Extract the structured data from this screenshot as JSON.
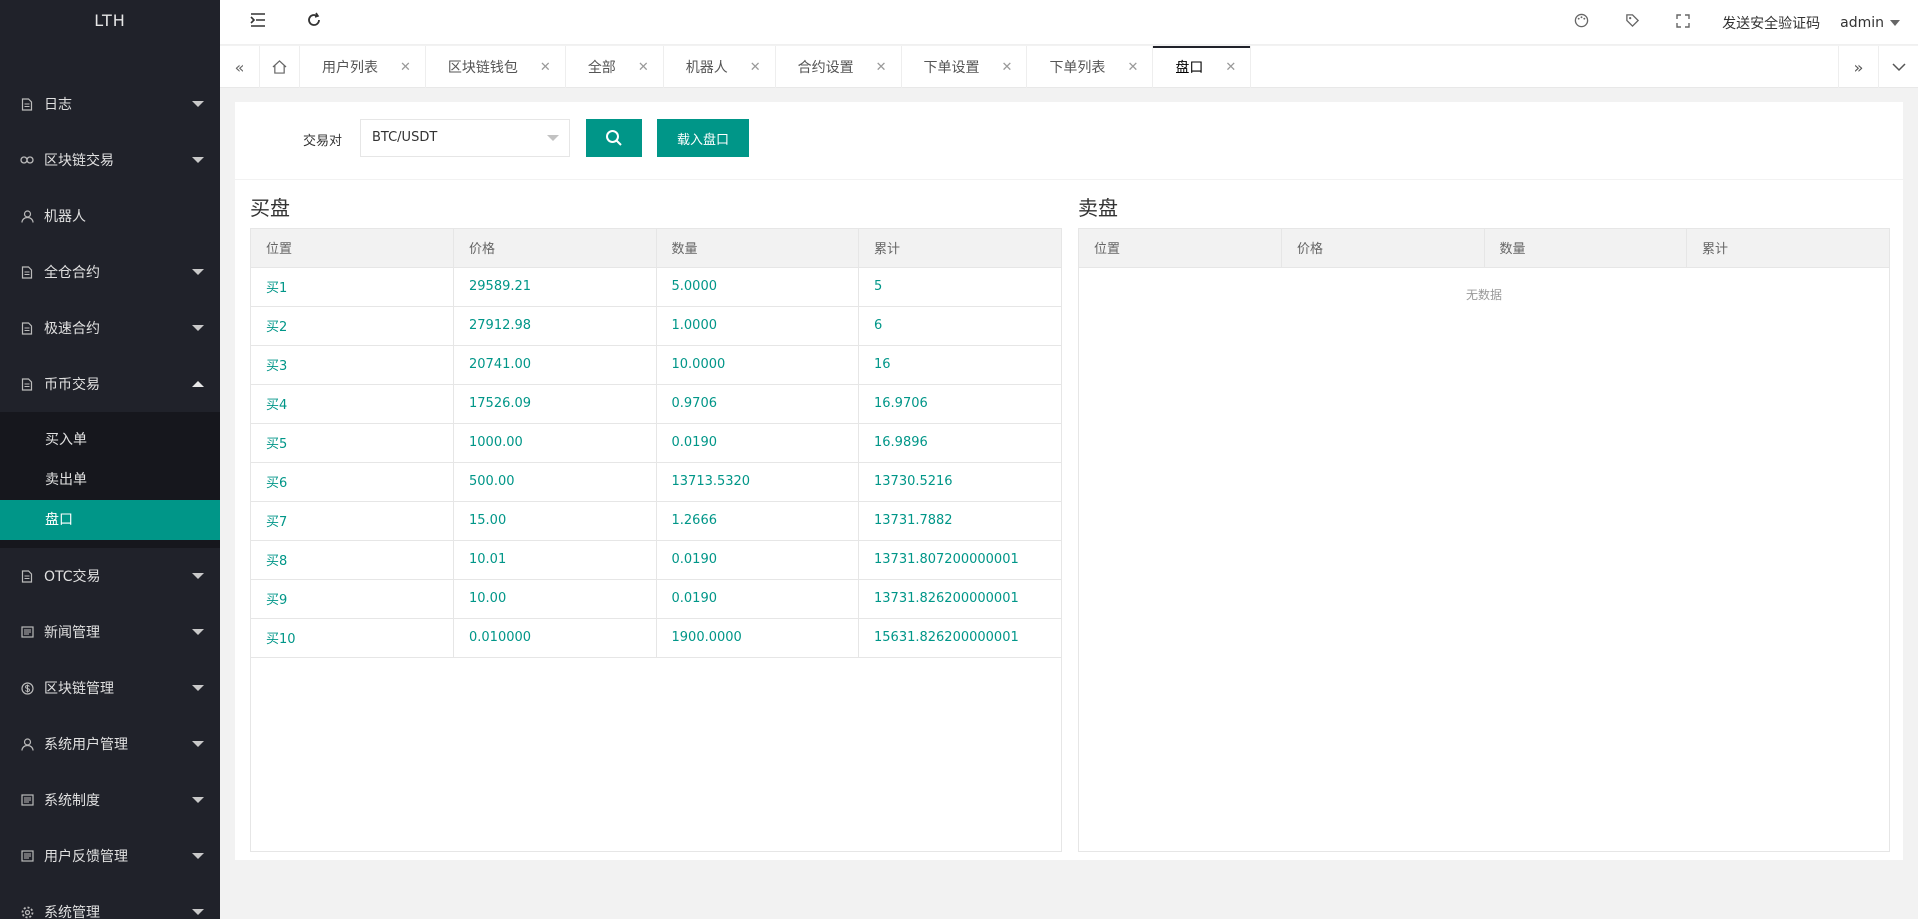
{
  "sidebar": {
    "logo": "LTH",
    "items": [
      {
        "label": "日志",
        "icon": "doc-icon"
      },
      {
        "label": "区块链交易",
        "icon": "link-icon"
      },
      {
        "label": "机器人",
        "icon": "user-icon"
      },
      {
        "label": "全仓合约",
        "icon": "doc-icon"
      },
      {
        "label": "极速合约",
        "icon": "doc-icon"
      },
      {
        "label": "币币交易",
        "icon": "doc-icon"
      }
    ],
    "subitems": [
      "买入单",
      "卖出单",
      "盘口"
    ],
    "items2": [
      {
        "label": "OTC交易",
        "icon": "doc-icon"
      },
      {
        "label": "新闻管理",
        "icon": "news-icon"
      },
      {
        "label": "区块链管理",
        "icon": "dollar-icon"
      },
      {
        "label": "系统用户管理",
        "icon": "user-icon"
      },
      {
        "label": "系统制度",
        "icon": "news-icon"
      },
      {
        "label": "用户反馈管理",
        "icon": "news-icon"
      },
      {
        "label": "系统管理",
        "icon": "gear-icon"
      }
    ]
  },
  "header": {
    "send_code": "发送安全验证码",
    "user": "admin"
  },
  "tabs": [
    "用户列表",
    "区块链钱包",
    "全部",
    "机器人",
    "合约设置",
    "下单设置",
    "下单列表",
    "盘口"
  ],
  "form": {
    "label": "交易对",
    "pair": "BTC/USDT",
    "load_button": "载入盘口"
  },
  "buy": {
    "title": "买盘",
    "columns": [
      "位置",
      "价格",
      "数量",
      "累计"
    ],
    "rows": [
      [
        "买1",
        "29589.21",
        "5.0000",
        "5"
      ],
      [
        "买2",
        "27912.98",
        "1.0000",
        "6"
      ],
      [
        "买3",
        "20741.00",
        "10.0000",
        "16"
      ],
      [
        "买4",
        "17526.09",
        "0.9706",
        "16.9706"
      ],
      [
        "买5",
        "1000.00",
        "0.0190",
        "16.9896"
      ],
      [
        "买6",
        "500.00",
        "13713.5320",
        "13730.5216"
      ],
      [
        "买7",
        "15.00",
        "1.2666",
        "13731.7882"
      ],
      [
        "买8",
        "10.01",
        "0.0190",
        "13731.807200000001"
      ],
      [
        "买9",
        "10.00",
        "0.0190",
        "13731.826200000001"
      ],
      [
        "买10",
        "0.010000",
        "1900.0000",
        "15631.826200000001"
      ]
    ]
  },
  "sell": {
    "title": "卖盘",
    "columns": [
      "位置",
      "价格",
      "数量",
      "累计"
    ],
    "empty": "无数据"
  }
}
